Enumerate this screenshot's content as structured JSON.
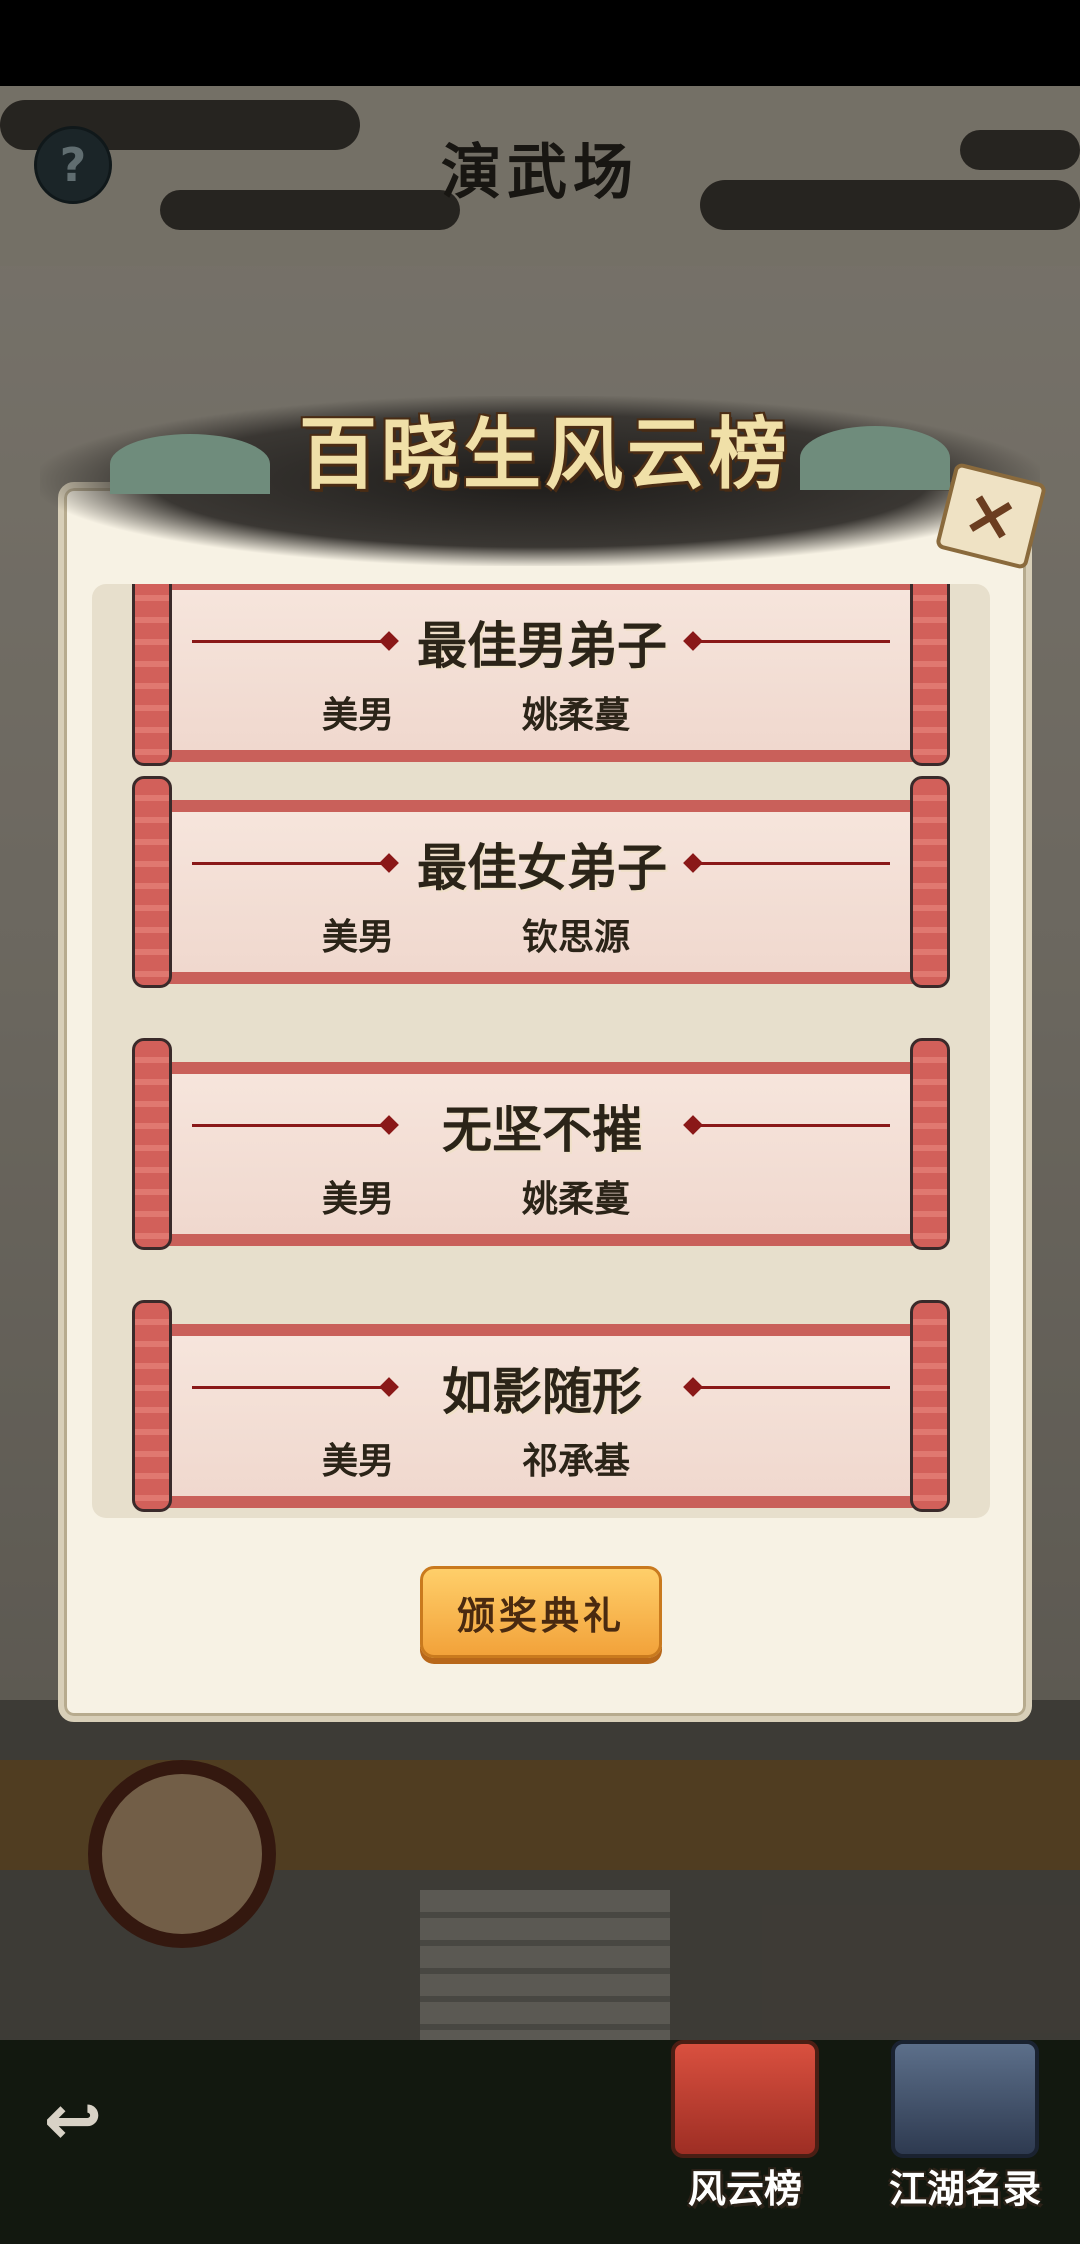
{
  "header": {
    "title": "演武场",
    "help_icon": "?"
  },
  "panel": {
    "title": "百晓生风云榜",
    "close_glyph": "×",
    "awards": [
      {
        "title": "最佳男弟子",
        "category": "美男",
        "winner": "姚柔蔓"
      },
      {
        "title": "最佳女弟子",
        "category": "美男",
        "winner": "钦思源"
      },
      {
        "title": "无坚不摧",
        "category": "美男",
        "winner": "姚柔蔓"
      },
      {
        "title": "如影随形",
        "category": "美男",
        "winner": "祁承基"
      }
    ],
    "ceremony_button": "颁奖典礼"
  },
  "bottom_nav": {
    "back_glyph": "↩",
    "items": [
      {
        "label": "风云榜",
        "icon": "scroll-icon"
      },
      {
        "label": "江湖名录",
        "icon": "book-icon"
      }
    ]
  },
  "colors": {
    "button_orange": "#f2a23a",
    "scroll_red": "#c9605a",
    "panel_bg": "#f7f2e4"
  }
}
